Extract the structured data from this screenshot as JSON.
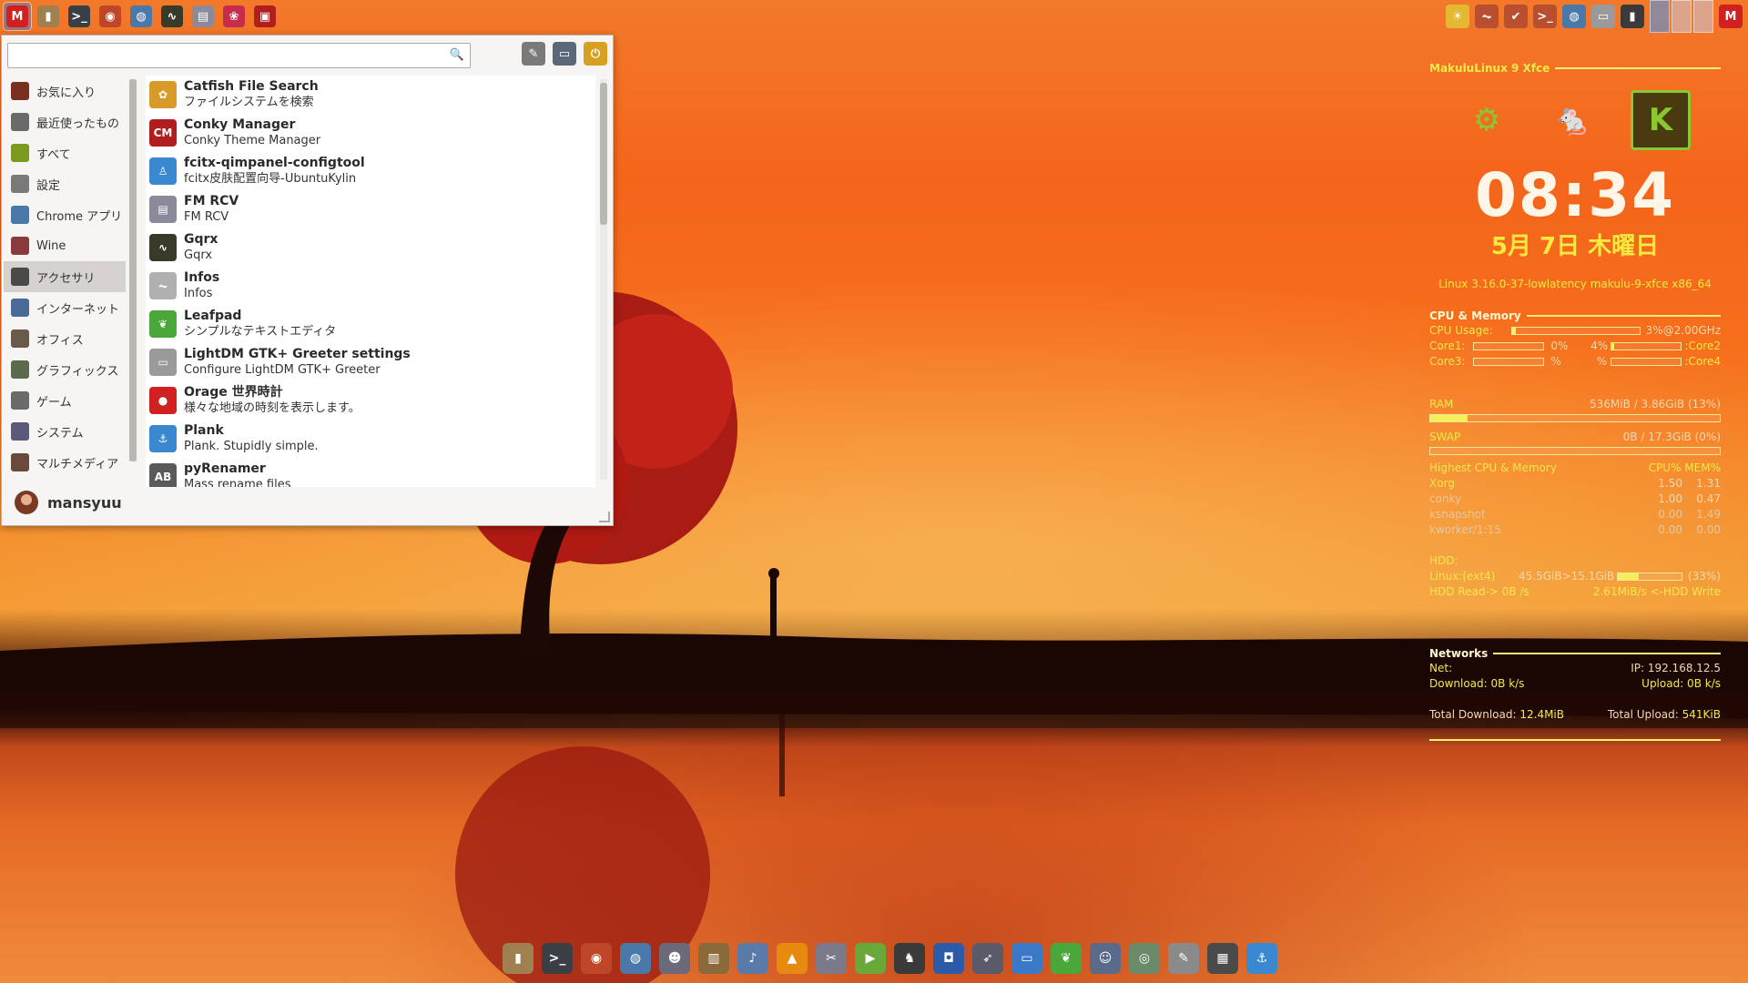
{
  "top_panel": {
    "launchers": [
      {
        "icon": "makulu-menu-icon",
        "glyph": "M",
        "color": "#d02020",
        "active": true
      },
      {
        "icon": "trash-icon",
        "glyph": "▮",
        "color": "#a08050"
      },
      {
        "icon": "terminal-icon",
        "glyph": ">_",
        "color": "#3a3f46"
      },
      {
        "icon": "firefox-icon",
        "glyph": "◉",
        "color": "#c0462a"
      },
      {
        "icon": "globe-icon",
        "glyph": "◍",
        "color": "#4a78a8"
      },
      {
        "icon": "system-monitor-icon",
        "glyph": "∿",
        "color": "#3a3a2a"
      },
      {
        "icon": "printer-icon",
        "glyph": "▤",
        "color": "#8a8a9a"
      },
      {
        "icon": "raspberry-icon",
        "glyph": "❀",
        "color": "#c62d4c"
      },
      {
        "icon": "screen-recorder-icon",
        "glyph": "▣",
        "color": "#b01e1e"
      }
    ],
    "tray": [
      {
        "icon": "weather-icon",
        "glyph": "☀",
        "color": "#e4b830"
      },
      {
        "icon": "activity-icon",
        "glyph": "⏦",
        "color": "#b85030"
      },
      {
        "icon": "bird-icon",
        "glyph": "✔",
        "color": "#b85030"
      },
      {
        "icon": "prompt-icon",
        "glyph": ">_",
        "color": "#b85030"
      },
      {
        "icon": "network-globe-icon",
        "glyph": "◍",
        "color": "#4a78a8"
      },
      {
        "icon": "card-icon",
        "glyph": "▭",
        "color": "#9a9a9a"
      },
      {
        "icon": "battery-icon",
        "glyph": "▮",
        "color": "#3a3a3a"
      }
    ],
    "end_icon": {
      "icon": "makulu-logo-icon",
      "glyph": "M",
      "color": "#d02020"
    }
  },
  "menu": {
    "search": {
      "value": "",
      "placeholder": ""
    },
    "tools": [
      {
        "icon": "settings-manager-icon",
        "glyph": "✎",
        "color": "#7a7a7a"
      },
      {
        "icon": "lock-screen-icon",
        "glyph": "▭",
        "color": "#5a6878"
      },
      {
        "icon": "logout-icon",
        "glyph": "⏻",
        "color": "#d8a020"
      }
    ],
    "categories": [
      {
        "label": "お気に入り",
        "icon": "favorites-icon",
        "color": "#7a3020",
        "selected": false
      },
      {
        "label": "最近使ったもの",
        "icon": "recent-icon",
        "color": "#6a6a6a",
        "selected": false
      },
      {
        "label": "すべて",
        "icon": "all-apps-icon",
        "color": "#7a9a20",
        "selected": false
      },
      {
        "label": "設定",
        "icon": "settings-icon",
        "color": "#7a7a7a",
        "selected": false
      },
      {
        "label": "Chrome アプリ",
        "icon": "chrome-apps-icon",
        "color": "#4a78a8",
        "selected": false
      },
      {
        "label": "Wine",
        "icon": "wine-icon",
        "color": "#8a3a3a",
        "selected": false
      },
      {
        "label": "アクセサリ",
        "icon": "accessories-icon",
        "color": "#4a4a4a",
        "selected": true
      },
      {
        "label": "インターネット",
        "icon": "internet-icon",
        "color": "#4a6a98",
        "selected": false
      },
      {
        "label": "オフィス",
        "icon": "office-icon",
        "color": "#6a5a4a",
        "selected": false
      },
      {
        "label": "グラフィックス",
        "icon": "graphics-icon",
        "color": "#5a6a4a",
        "selected": false
      },
      {
        "label": "ゲーム",
        "icon": "games-icon",
        "color": "#6a6a6a",
        "selected": false
      },
      {
        "label": "システム",
        "icon": "system-icon",
        "color": "#5a5a7a",
        "selected": false
      },
      {
        "label": "マルチメディア",
        "icon": "multimedia-icon",
        "color": "#6a4a3a",
        "selected": false
      }
    ],
    "apps": [
      {
        "name": "Catfish File Search",
        "desc": "ファイルシステムを検索",
        "icon": "catfish-icon",
        "glyph": "✿",
        "color": "#d89a28"
      },
      {
        "name": "Conky Manager",
        "desc": "Conky Theme Manager",
        "icon": "conky-manager-icon",
        "glyph": "CM",
        "color": "#b01e1e"
      },
      {
        "name": "fcitx-qimpanel-configtool",
        "desc": "fcitx皮肤配置向导-UbuntuKylin",
        "icon": "fcitx-icon",
        "glyph": "♙",
        "color": "#3a88d0"
      },
      {
        "name": "FM RCV",
        "desc": "FM RCV",
        "icon": "fm-rcv-icon",
        "glyph": "▤",
        "color": "#8a8a9a"
      },
      {
        "name": "Gqrx",
        "desc": "Gqrx",
        "icon": "gqrx-icon",
        "glyph": "∿",
        "color": "#3a3a2a"
      },
      {
        "name": "Infos",
        "desc": "Infos",
        "icon": "infos-icon",
        "glyph": "⏦",
        "color": "#b0b0b0"
      },
      {
        "name": "Leafpad",
        "desc": "シンプルなテキストエディタ",
        "icon": "leafpad-icon",
        "glyph": "❦",
        "color": "#4aa83a"
      },
      {
        "name": "LightDM GTK+ Greeter settings",
        "desc": "Configure LightDM GTK+ Greeter",
        "icon": "lightdm-icon",
        "glyph": "▭",
        "color": "#9a9a9a"
      },
      {
        "name": "Orage 世界時計",
        "desc": "様々な地域の時刻を表示します。",
        "icon": "orage-clock-icon",
        "glyph": "●",
        "color": "#d02020"
      },
      {
        "name": "Plank",
        "desc": "Plank. Stupidly simple.",
        "icon": "plank-icon",
        "glyph": "⚓",
        "color": "#3a88d0"
      },
      {
        "name": "pyRenamer",
        "desc": "Mass rename files",
        "icon": "pyrenamer-icon",
        "glyph": "AB",
        "color": "#5a5a5a"
      }
    ],
    "user": {
      "name": "mansyuu",
      "icon": "user-avatar-icon"
    }
  },
  "conky": {
    "title": "MakuluLinux 9 Xfce",
    "logos": [
      {
        "icon": "ubuntu-logo-icon",
        "glyph": "⚙",
        "color": "#8ac830"
      },
      {
        "icon": "xfce-mouse-logo-icon",
        "glyph": "🐁",
        "color": "#8ac830"
      },
      {
        "icon": "kylin-logo-icon",
        "glyph": "K",
        "color": "#8ac830"
      }
    ],
    "time": "08:34",
    "date": "5月  7日 木曜日",
    "kernel": "Linux 3.16.0-37-lowlatency makulu-9-xfce  x86_64",
    "cpu": {
      "header": "CPU & Memory",
      "usage_label": "CPU Usage:",
      "usage_value": "3%@2.00GHz",
      "usage_fraction": 0.03,
      "cores": [
        {
          "label": "Core1:",
          "value": "0%",
          "fraction": 0.0
        },
        {
          "label": ":Core2",
          "value": "4%",
          "fraction": 0.04
        },
        {
          "label": "Core3:",
          "value": "%",
          "fraction": 0.0
        },
        {
          "label": ":Core4",
          "value": "%",
          "fraction": 0.0
        }
      ]
    },
    "ram": {
      "label": "RAM",
      "value": "536MiB / 3.86GiB (13%)",
      "fraction": 0.13
    },
    "swap": {
      "label": "SWAP",
      "value": "0B  / 17.3GiB (0%)",
      "fraction": 0.0
    },
    "processes": {
      "header": "Highest CPU & Memory",
      "columns": "CPU% MEM%",
      "rows": [
        {
          "name": "Xorg",
          "cpu": "1.50",
          "mem": "1.31"
        },
        {
          "name": "conky",
          "cpu": "1.00",
          "mem": "0.47"
        },
        {
          "name": "ksnapshot",
          "cpu": "0.00",
          "mem": "1.49"
        },
        {
          "name": "kworker/1:15",
          "cpu": "0.00",
          "mem": "0.00"
        }
      ]
    },
    "hdd": {
      "header": "HDD:",
      "fs_label": "Linux:(ext4)",
      "fs_usage": "45.5GiB>15.1GiB",
      "fs_percent": "(33%)",
      "fs_fraction": 0.33,
      "read": "HDD Read-> 0B  /s",
      "write": "2.61MiB/s <-HDD Write"
    },
    "net": {
      "header": "Networks",
      "net_label": "Net:",
      "ip": "IP: 192.168.12.5",
      "download": "Download: 0B   k/s",
      "upload": "Upload:  0B   k/s",
      "total_download_label": "Total Download:",
      "total_download_value": "12.4MiB",
      "total_upload_label": "Total Upload:",
      "total_upload_value": "541KiB"
    }
  },
  "dock": [
    {
      "icon": "trash-dock-icon",
      "glyph": "▮",
      "color": "#a08050"
    },
    {
      "icon": "terminal-dock-icon",
      "glyph": ">_",
      "color": "#3a3f46"
    },
    {
      "icon": "firefox-dock-icon",
      "glyph": "◉",
      "color": "#c0462a"
    },
    {
      "icon": "browser-dock-icon",
      "glyph": "◍",
      "color": "#4a78a8"
    },
    {
      "icon": "kodi-dock-icon",
      "glyph": "☻",
      "color": "#6a6a7a"
    },
    {
      "icon": "archive-dock-icon",
      "glyph": "▥",
      "color": "#8a6a3a"
    },
    {
      "icon": "guitar-dock-icon",
      "glyph": "♪",
      "color": "#5a7aa8"
    },
    {
      "icon": "vlc-dock-icon",
      "glyph": "▲",
      "color": "#e88a10"
    },
    {
      "icon": "tools-dock-icon",
      "glyph": "✂",
      "color": "#7a7a8a"
    },
    {
      "icon": "media-player-dock-icon",
      "glyph": "▶",
      "color": "#6aa83a"
    },
    {
      "icon": "tux-dock-icon",
      "glyph": "♞",
      "color": "#3a3a3a"
    },
    {
      "icon": "screenshot-dock-icon",
      "glyph": "◘",
      "color": "#2a5aa8"
    },
    {
      "icon": "rocket-dock-icon",
      "glyph": "➶",
      "color": "#5a5a6a"
    },
    {
      "icon": "display-dock-icon",
      "glyph": "▭",
      "color": "#3a78c8"
    },
    {
      "icon": "leaf-dock-icon",
      "glyph": "❦",
      "color": "#4aa83a"
    },
    {
      "icon": "user-dock-icon",
      "glyph": "☺",
      "color": "#5a6a8a"
    },
    {
      "icon": "network-dock-icon",
      "glyph": "◎",
      "color": "#6a8a6a"
    },
    {
      "icon": "settings-dock-icon",
      "glyph": "✎",
      "color": "#8a8a8a"
    },
    {
      "icon": "workspaces-dock-icon",
      "glyph": "▦",
      "color": "#4a4a4a"
    },
    {
      "icon": "plank-dock-icon",
      "glyph": "⚓",
      "color": "#3a88d0"
    }
  ]
}
